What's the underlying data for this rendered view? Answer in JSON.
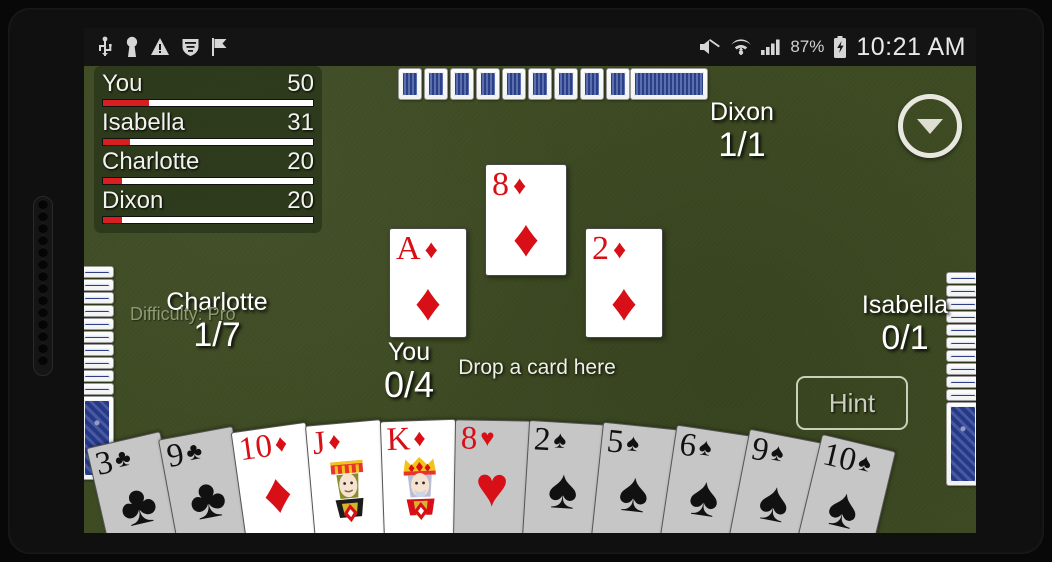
{
  "statusbar": {
    "icons_left": [
      "usb-icon",
      "key-icon",
      "warning-icon",
      "vpn-shield-icon",
      "flag-icon"
    ],
    "icons_right": [
      "mute-icon",
      "wifi-icon",
      "signal-icon"
    ],
    "battery_percent": "87%",
    "battery_icon": "battery-charging-icon",
    "clock": "10:21 AM"
  },
  "scoreboard": {
    "rows": [
      {
        "name": "You",
        "score": "50",
        "bar_pct": 22
      },
      {
        "name": "Isabella",
        "score": "31",
        "bar_pct": 13
      },
      {
        "name": "Charlotte",
        "score": "20",
        "bar_pct": 9
      },
      {
        "name": "Dixon",
        "score": "20",
        "bar_pct": 9
      }
    ],
    "difficulty": "Difficulty: Pro",
    "bar_fill_color": "#d81e1e",
    "bar_track_color": "#ffffff"
  },
  "menu_button": {
    "icon": "chevron-down-circle-icon"
  },
  "players": {
    "dixon": {
      "name": "Dixon",
      "tricks": "1/1"
    },
    "charlotte": {
      "name": "Charlotte",
      "tricks": "1/7"
    },
    "isabella": {
      "name": "Isabella",
      "tricks": "0/1"
    },
    "you": {
      "name": "You",
      "tricks": "0/4"
    }
  },
  "hint_button": {
    "label": "Hint"
  },
  "drop_zone": {
    "label": "Drop a card here"
  },
  "played_cards": [
    {
      "rank": "A",
      "suit": "♦",
      "color": "red",
      "pos": "left"
    },
    {
      "rank": "8",
      "suit": "♦",
      "color": "red",
      "pos": "center"
    },
    {
      "rank": "2",
      "suit": "♦",
      "color": "red",
      "pos": "right"
    }
  ],
  "hand": [
    {
      "rank": "3",
      "suit": "♣",
      "color": "black",
      "playable": false
    },
    {
      "rank": "9",
      "suit": "♣",
      "color": "black",
      "playable": false
    },
    {
      "rank": "10",
      "suit": "♦",
      "color": "red",
      "playable": true
    },
    {
      "rank": "J",
      "suit": "♦",
      "color": "red",
      "playable": true,
      "court": true
    },
    {
      "rank": "K",
      "suit": "♦",
      "color": "red",
      "playable": true,
      "court": true
    },
    {
      "rank": "8",
      "suit": "♥",
      "color": "red",
      "playable": false
    },
    {
      "rank": "2",
      "suit": "♠",
      "color": "black",
      "playable": false
    },
    {
      "rank": "5",
      "suit": "♠",
      "color": "black",
      "playable": false
    },
    {
      "rank": "6",
      "suit": "♠",
      "color": "black",
      "playable": false
    },
    {
      "rank": "9",
      "suit": "♠",
      "color": "black",
      "playable": false
    },
    {
      "rank": "10",
      "suit": "♠",
      "color": "black",
      "playable": false
    }
  ],
  "opponent_hands": {
    "dixon_cards": 10,
    "charlotte_cards": 11,
    "isabella_cards": 11
  },
  "colors": {
    "felt": "#3d4a22",
    "card_red": "#d80f16",
    "card_back": "#25398a",
    "panel": "rgba(40,52,24,.78)"
  }
}
